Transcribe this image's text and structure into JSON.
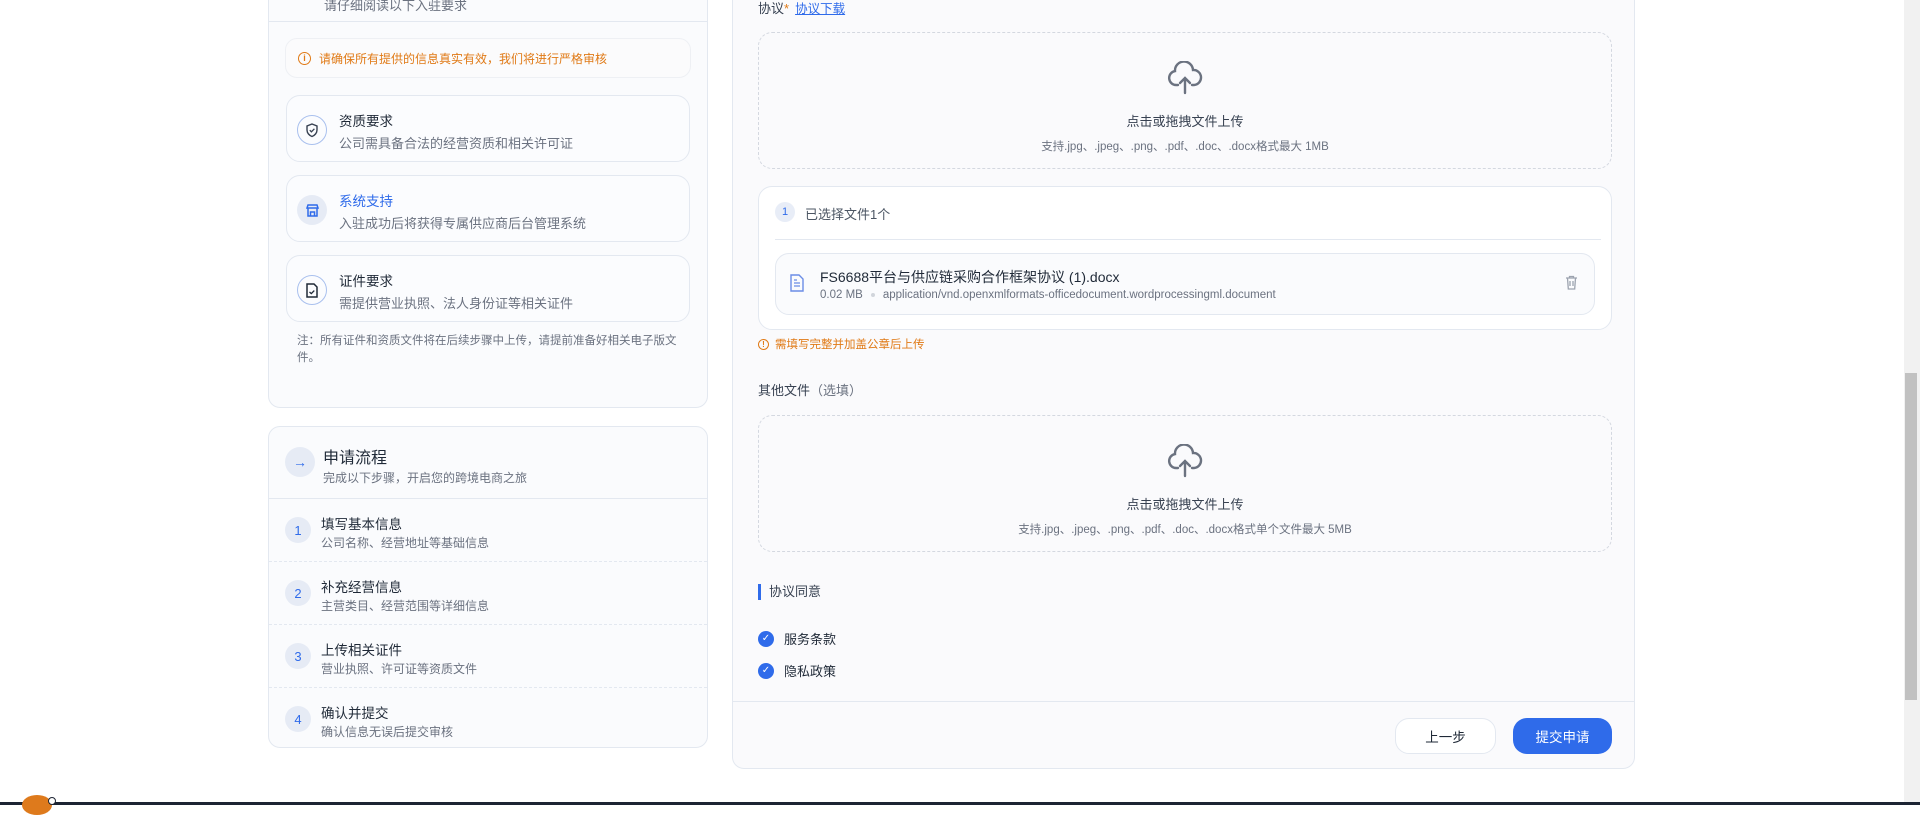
{
  "requirements": {
    "cut_text": "请仔细阅读以下入驻要求",
    "warning": "请确保所有提供的信息真实有效，我们将进行严格审核",
    "items": [
      {
        "title": "资质要求",
        "desc": "公司需具备合法的经营资质和相关许可证",
        "icon": "shield-check-icon"
      },
      {
        "title": "系统支持",
        "desc": "入驻成功后将获得专属供应商后台管理系统",
        "icon": "store-icon"
      },
      {
        "title": "证件要求",
        "desc": "需提供营业执照、法人身份证等相关证件",
        "icon": "file-check-icon"
      }
    ],
    "note": "注：所有证件和资质文件将在后续步骤中上传，请提前准备好相关电子版文件。"
  },
  "process": {
    "title": "申请流程",
    "subtitle": "完成以下步骤，开启您的跨境电商之旅",
    "steps": [
      {
        "num": "1",
        "title": "填写基本信息",
        "desc": "公司名称、经营地址等基础信息"
      },
      {
        "num": "2",
        "title": "补充经营信息",
        "desc": "主营类目、经营范围等详细信息"
      },
      {
        "num": "3",
        "title": "上传相关证件",
        "desc": "营业执照、许可证等资质文件"
      },
      {
        "num": "4",
        "title": "确认并提交",
        "desc": "确认信息无误后提交审核"
      }
    ]
  },
  "form": {
    "agreement_label": "协议",
    "required_mark": "*",
    "agreement_download": "协议下载",
    "upload1": {
      "title": "点击或拖拽文件上传",
      "hint": "支持.jpg、.jpeg、.png、.pdf、.doc、.docx格式最大 1MB"
    },
    "selected": {
      "count": "1",
      "label": "已选择文件1个",
      "file": {
        "name": "FS6688平台与供应链采购合作框架协议 (1).docx",
        "size": "0.02 MB",
        "type": "application/vnd.openxmlformats-officedocument.wordprocessingml.document"
      }
    },
    "stamp_warning": "需填写完整并加盖公章后上传",
    "other_label": "其他文件",
    "other_optional": "（选填）",
    "upload2": {
      "title": "点击或拖拽文件上传",
      "hint": "支持.jpg、.jpeg、.png、.pdf、.doc、.docx格式单个文件最大 5MB"
    },
    "consent_title": "协议同意",
    "consents": [
      {
        "label": "服务条款",
        "checked": true
      },
      {
        "label": "隐私政策",
        "checked": true
      }
    ],
    "prev_button": "上一步",
    "submit_button": "提交申请"
  },
  "colors": {
    "accent": "#2f6bea",
    "warning": "#e07a16"
  }
}
